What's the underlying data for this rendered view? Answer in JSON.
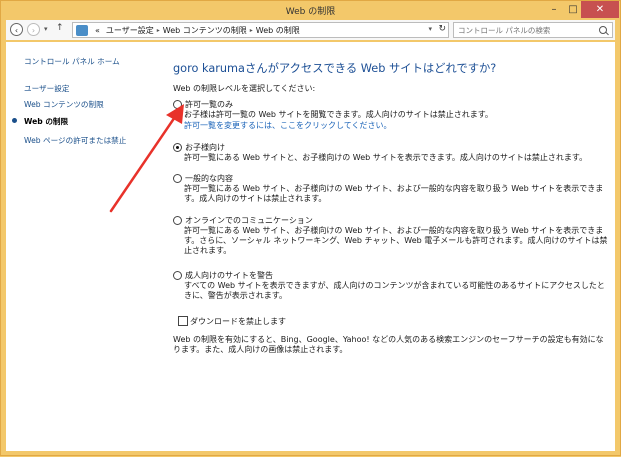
{
  "window": {
    "title": "Web の制限",
    "minimize": "–",
    "maximize": "□",
    "close": "✕"
  },
  "address": {
    "back": "‹",
    "forward": "›",
    "dropdown": "▾",
    "up": "↑",
    "crumbs": [
      "«",
      "ユーザー設定",
      "Web コンテンツの制限",
      "Web の制限"
    ],
    "sep": "▸",
    "path_dropdown": "▾",
    "refresh": "↻"
  },
  "search": {
    "placeholder": "コントロール パネルの検索"
  },
  "sidebar": {
    "home": "コントロール パネル ホーム",
    "users": "ユーザー設定",
    "web_content": "Web コンテンツの制限",
    "web_restrict": "Web の制限",
    "allowed_pages": "Web ページの許可または禁止"
  },
  "main": {
    "heading": "goro karumaさんがアクセスできる Web サイトはどれですか?",
    "subheading": "Web の制限レベルを選択してください:",
    "options": [
      {
        "label": "許可一覧のみ",
        "desc": "お子様は許可一覧の Web サイトを閲覧できます。成人向けのサイトは禁止されます。",
        "link": "許可一覧を変更するには、ここをクリックしてください。",
        "selected": false
      },
      {
        "label": "お子様向け",
        "desc": "許可一覧にある Web サイトと、お子様向けの Web サイトを表示できます。成人向けのサイトは禁止されます。",
        "selected": true
      },
      {
        "label": "一般的な内容",
        "desc": "許可一覧にある Web サイト、お子様向けの Web サイト、および一般的な内容を取り扱う Web サイトを表示できます。成人向けのサイトは禁止されます。",
        "selected": false
      },
      {
        "label": "オンラインでのコミュニケーション",
        "desc": "許可一覧にある Web サイト、お子様向けの Web サイト、および一般的な内容を取り扱う Web サイトを表示できます。さらに、ソーシャル ネットワーキング、Web チャット、Web 電子メールも許可されます。成人向けのサイトは禁止されます。",
        "selected": false
      },
      {
        "label": "成人向けのサイトを警告",
        "desc": "すべての Web サイトを表示できますが、成人向けのコンテンツが含まれている可能性のあるサイトにアクセスしたときに、警告が表示されます。",
        "selected": false
      }
    ],
    "block_downloads": "ダウンロードを禁止します",
    "footer": "Web の制限を有効にすると、Bing、Google、Yahoo! などの人気のある検索エンジンのセーフサーチの設定も有効になります。また、成人向けの画像は禁止されます。"
  },
  "colors": {
    "frame": "#f3c86a",
    "close": "#c75050",
    "heading": "#1c4f95",
    "link": "#1a63b8",
    "arrow": "#e8322a"
  },
  "icons": {
    "back": "back-arrow-icon",
    "forward": "forward-arrow-icon",
    "up": "up-arrow-icon",
    "refresh": "refresh-icon",
    "search": "search-icon",
    "control_panel": "control-panel-icon"
  }
}
